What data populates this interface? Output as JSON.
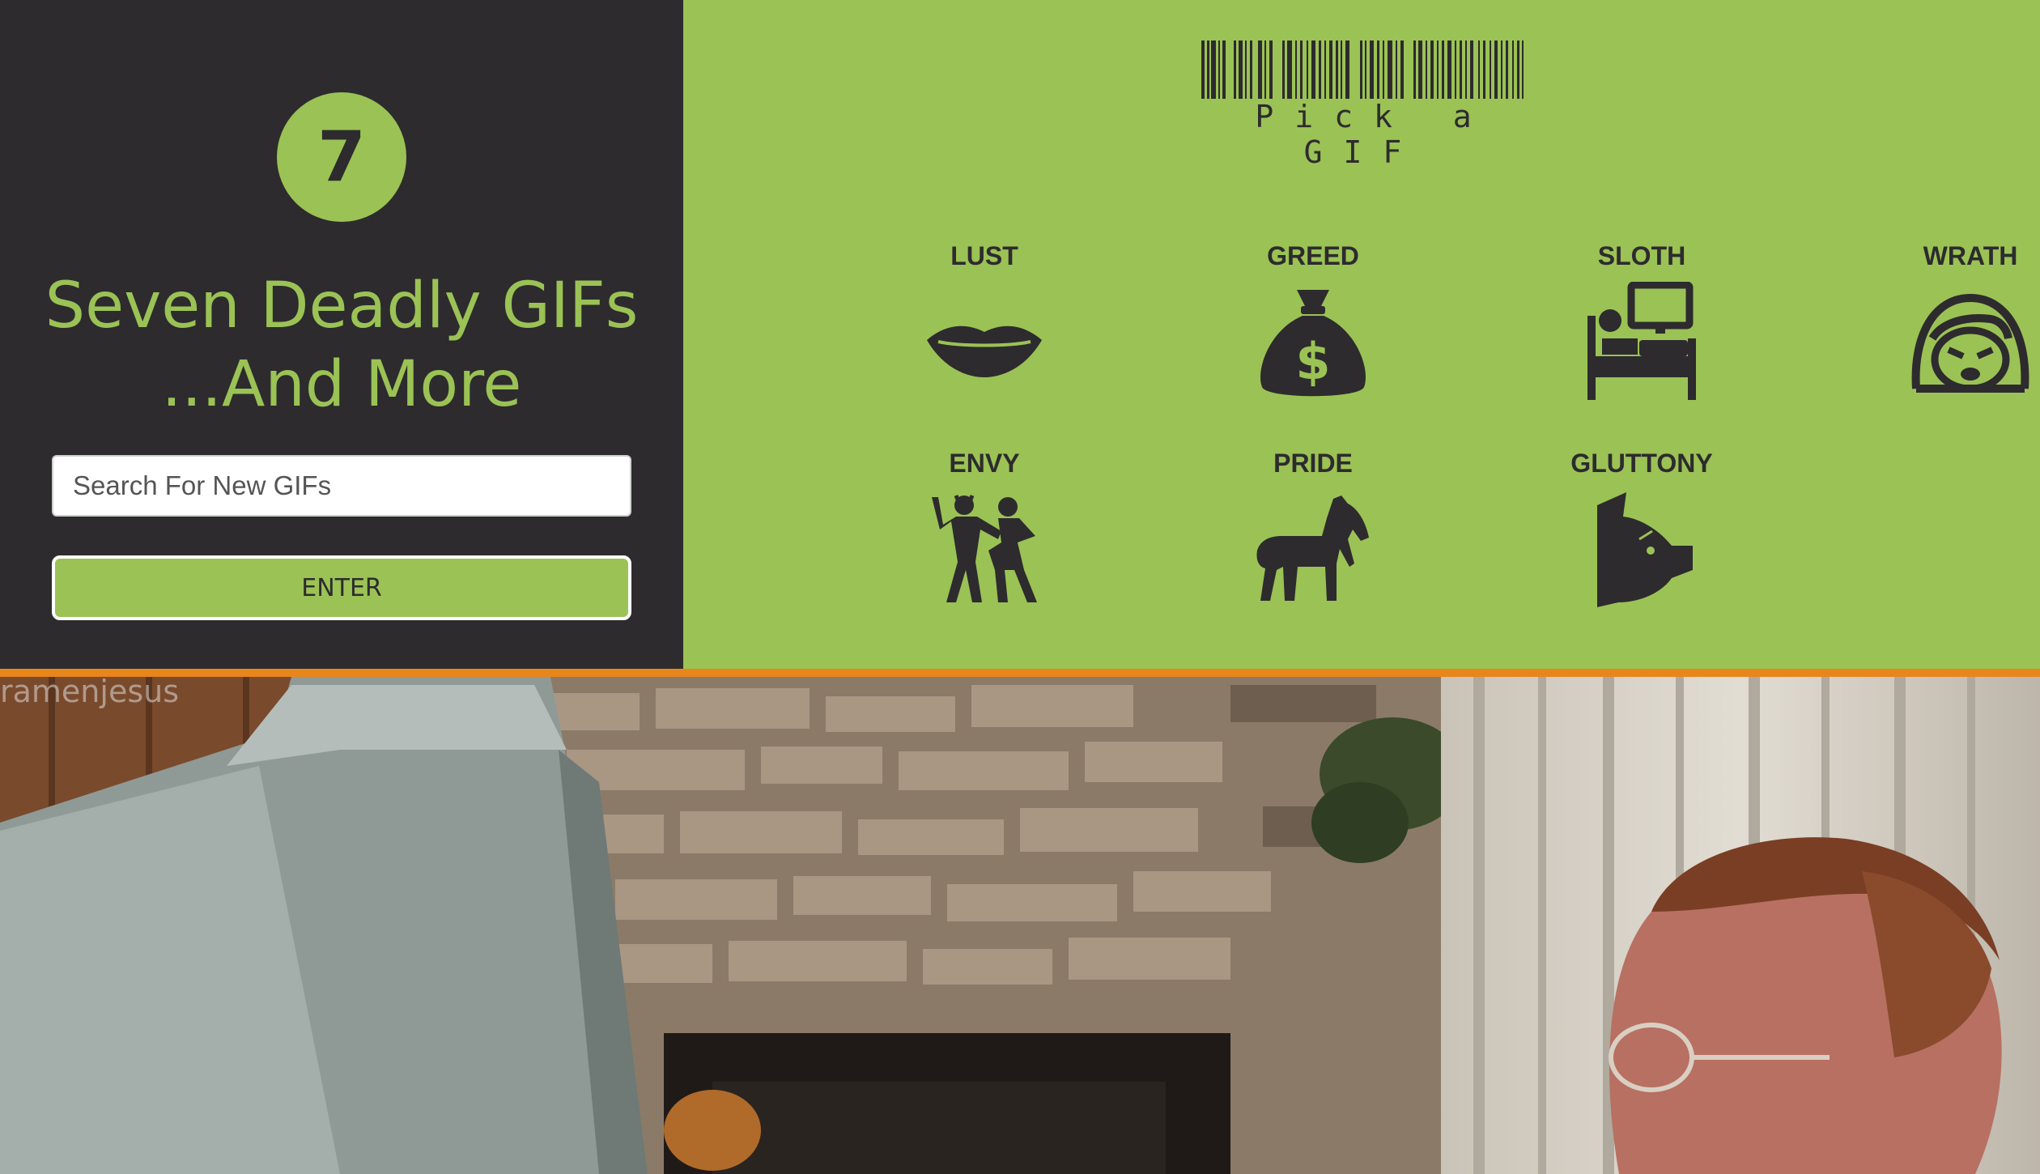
{
  "app": {
    "logo_number": "7",
    "title_line1": "Seven Deadly GIFs",
    "title_line2": "...And More"
  },
  "search": {
    "placeholder": "Search For New GIFs",
    "value": "",
    "button_label": "ENTER"
  },
  "menu": {
    "header_label": "Pick a GIF",
    "sins": [
      {
        "label": "LUST",
        "icon": "lips-icon"
      },
      {
        "label": "GREED",
        "icon": "money-bag-icon"
      },
      {
        "label": "SLOTH",
        "icon": "bed-tv-icon"
      },
      {
        "label": "WRATH",
        "icon": "angry-face-icon"
      },
      {
        "label": "ENVY",
        "icon": "dancing-couple-icon"
      },
      {
        "label": "PRIDE",
        "icon": "horse-icon"
      },
      {
        "label": "GLUTTONY",
        "icon": "pig-icon"
      }
    ]
  },
  "gif": {
    "watermark": "ramenjesus"
  },
  "colors": {
    "accent_green": "#9bc255",
    "dark": "#2d2b2e",
    "divider_orange": "#e8861c"
  }
}
